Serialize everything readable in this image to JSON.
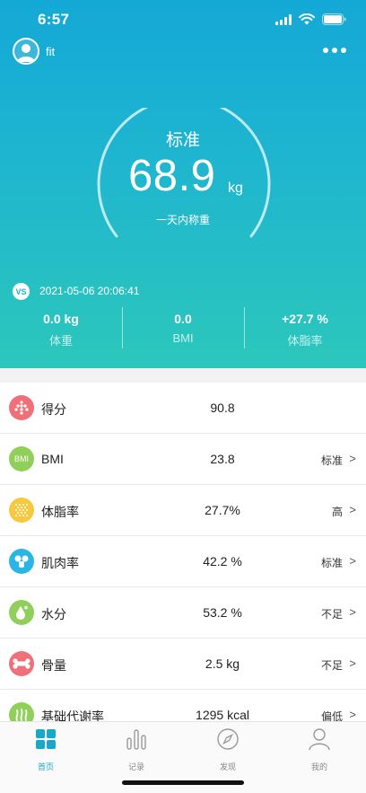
{
  "status_bar": {
    "time": "6:57"
  },
  "user": {
    "name": "fit"
  },
  "weight": {
    "status": "标准",
    "value": "68.9",
    "unit": "kg",
    "subtitle": "一天内称重"
  },
  "compare": {
    "badge": "VS",
    "date": "2021-05-06 20:06:41",
    "items": [
      {
        "value": "0.0 kg",
        "label": "体重"
      },
      {
        "value": "0.0",
        "label": "BMI"
      },
      {
        "value": "+27.7 %",
        "label": "体脂率"
      }
    ]
  },
  "metrics": [
    {
      "name": "得分",
      "value": "90.8",
      "level": "",
      "icon": "score-icon",
      "color": "#f0707a"
    },
    {
      "name": "BMI",
      "value": "23.8",
      "level": "标准",
      "icon": "bmi-icon",
      "icon_text": "BMI",
      "color": "#8fcf5a"
    },
    {
      "name": "体脂率",
      "value": "27.7%",
      "level": "高",
      "icon": "body-fat-icon",
      "color": "#f7c840"
    },
    {
      "name": "肌肉率",
      "value": "42.2 %",
      "level": "标准",
      "icon": "muscle-icon",
      "color": "#29b6e6"
    },
    {
      "name": "水分",
      "value": "53.2 %",
      "level": "不足",
      "icon": "water-icon",
      "color": "#8fcf5a"
    },
    {
      "name": "骨量",
      "value": "2.5 kg",
      "level": "不足",
      "icon": "bone-icon",
      "color": "#f0707a"
    },
    {
      "name": "基础代谢率",
      "value": "1295 kcal",
      "level": "偏低",
      "icon": "metabolism-icon",
      "color": "#8fcf5a"
    }
  ],
  "tabs": [
    {
      "label": "首页",
      "icon": "home-icon",
      "active": true
    },
    {
      "label": "记录",
      "icon": "records-icon",
      "active": false
    },
    {
      "label": "发现",
      "icon": "discover-icon",
      "active": false
    },
    {
      "label": "我的",
      "icon": "profile-icon",
      "active": false
    }
  ],
  "colors": {
    "accent": "#1aa8c8",
    "hero_top": "#14a8d6",
    "hero_bottom": "#2cc7bb"
  }
}
